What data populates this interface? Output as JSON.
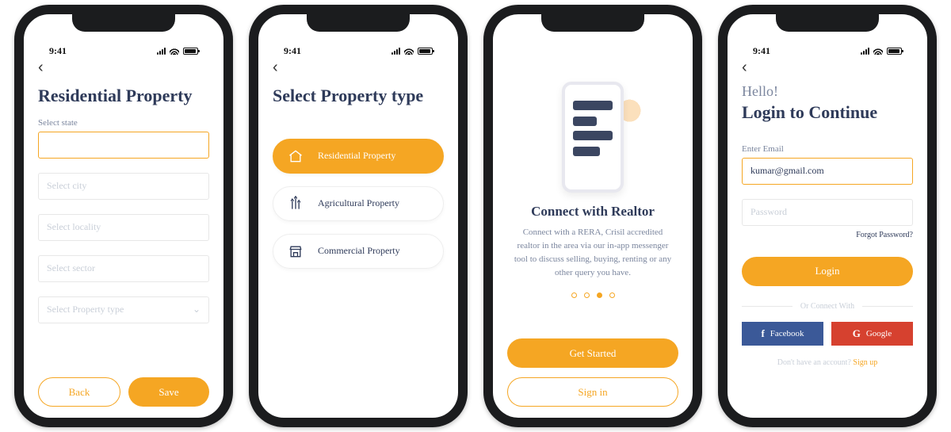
{
  "status": {
    "time": "9:41"
  },
  "screen1": {
    "title": "Residential Property",
    "state_label": "Select state",
    "fields": {
      "state": "",
      "city_ph": "Select city",
      "locality_ph": "Select locality",
      "sector_ph": "Select sector",
      "ptype_ph": "Select Property type"
    },
    "back_btn": "Back",
    "save_btn": "Save"
  },
  "screen2": {
    "title": "Select Property type",
    "options": [
      {
        "label": "Residential Property",
        "selected": true
      },
      {
        "label": "Agricultural Property",
        "selected": false
      },
      {
        "label": "Commercial Property",
        "selected": false
      }
    ]
  },
  "screen3": {
    "title": "Connect with Realtor",
    "body": "Connect with a RERA, Crisil accredited realtor in the area via our in-app messenger tool to discuss selling, buying, renting or any other query you have.",
    "page_index": 2,
    "page_count": 4,
    "get_started": "Get Started",
    "sign_in": "Sign in"
  },
  "screen4": {
    "hello": "Hello!",
    "title": "Login to Continue",
    "email_label": "Enter Email",
    "email_value": "kumar@gmail.com",
    "password_ph": "Password",
    "forgot": "Forgot Password?",
    "login_btn": "Login",
    "or": "Or Connect With",
    "fb": "Facebook",
    "google": "Google",
    "no_account": "Don't have an account? ",
    "signup": "Sign up"
  }
}
